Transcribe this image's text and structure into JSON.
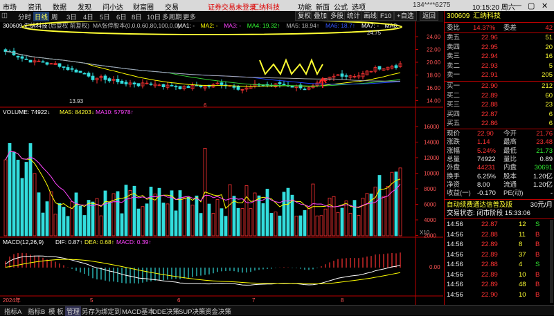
{
  "menubar": {
    "items": [
      "市场",
      "资讯",
      "数据",
      "发现",
      "问小达",
      "财富圈",
      "交易"
    ],
    "login_notice": "证券交易未登录",
    "stock_name": "汇纳科技",
    "right_items": [
      "功能",
      "新面",
      "公式",
      "选项"
    ],
    "time": "10:15:20 周六",
    "account": "134****6275"
  },
  "toolbar": {
    "left_items": [
      "分时",
      "日线",
      "周",
      "3日",
      "4日",
      "5日",
      "6日",
      "8日",
      "10日",
      "多周期",
      "更多"
    ],
    "active": "日线",
    "right_items": [
      "复权",
      "叠加",
      "多股",
      "统计",
      "画线",
      "F10",
      "+自选",
      "返回"
    ]
  },
  "main_chart": {
    "header_code_name": "300609 汇纳科技",
    "header_adj": "(后复权 前复权)",
    "ma_formula": "MA张停股本(0,0,0,60,80,100,0,0)",
    "ma_values": [
      {
        "label": "MA1: -",
        "color": "#ffffff"
      },
      {
        "label": "MA2: -",
        "color": "#ffff00"
      },
      {
        "label": "MA3: -",
        "color": "#ff44ff"
      },
      {
        "label": "MA4: 19.32↑",
        "color": "#33ff33"
      },
      {
        "label": "MA5: 18.94↑",
        "color": "#bbbbbb"
      },
      {
        "label": "MA6: 18.7↑",
        "color": "#3355ff"
      },
      {
        "label": "MA7: -",
        "color": "#ffffff"
      },
      {
        "label": "MA8: -",
        "color": "#ffffff"
      }
    ],
    "y_ticks": [
      "24.00",
      "22.00",
      "20.00",
      "18.00",
      "16.00",
      "14.00"
    ],
    "high_label": "24.75",
    "low_label": "13.93",
    "month_marker": "6"
  },
  "volume_chart": {
    "header": "VOLUME: 74922↓",
    "ma5": "MA5: 84203↓",
    "ma10": "MA10: 57978↑",
    "y_ticks": [
      "16000",
      "14000",
      "12000",
      "10000",
      "8000",
      "6000",
      "4000",
      "2000"
    ],
    "unit": "X10"
  },
  "macd_chart": {
    "header": "MACD(12,26,9)",
    "dif": "DIF: 0.87↑",
    "dea": "DEA: 0.68↑",
    "macd": "MACD: 0.39↑",
    "y_ticks": [
      "0.00"
    ],
    "x_labels": [
      "2024年",
      "5",
      "6",
      "7",
      "8"
    ]
  },
  "bottom_tabs": [
    "指标A",
    "指标B",
    "模 板",
    "管理",
    "另存为",
    "绑定到",
    "MACD基本",
    "DDE决策",
    "SUP决策",
    "资金决策"
  ],
  "right_panel": {
    "code": "300609",
    "name": "汇纳科技",
    "webi_label": "委比",
    "webi_value": "14.37%",
    "weicha_label": "委差",
    "weicha_value": "42",
    "asks": [
      {
        "label": "卖五",
        "price": "22.96",
        "vol": "51"
      },
      {
        "label": "卖四",
        "price": "22.95",
        "vol": "20"
      },
      {
        "label": "卖三",
        "price": "22.94",
        "vol": "16"
      },
      {
        "label": "卖二",
        "price": "22.93",
        "vol": "5"
      },
      {
        "label": "卖一",
        "price": "22.91",
        "vol": "205"
      }
    ],
    "bids": [
      {
        "label": "买一",
        "price": "22.90",
        "vol": "212"
      },
      {
        "label": "买二",
        "price": "22.89",
        "vol": "60"
      },
      {
        "label": "买三",
        "price": "22.88",
        "vol": "23"
      },
      {
        "label": "买四",
        "price": "22.87",
        "vol": "6"
      },
      {
        "label": "买五",
        "price": "22.86",
        "vol": "6"
      }
    ],
    "quote": [
      {
        "l1": "现价",
        "v1": "22.90",
        "l2": "今开",
        "v2": "21.76"
      },
      {
        "l1": "涨跌",
        "v1": "1.14",
        "l2": "最高",
        "v2": "23.48"
      },
      {
        "l1": "涨幅",
        "v1": "5.24%",
        "l2": "最低",
        "v2": "21.73"
      },
      {
        "l1": "总量",
        "v1": "74922",
        "l2": "量比",
        "v2": "0.89"
      },
      {
        "l1": "外盘",
        "v1": "44231",
        "l2": "内盘",
        "v2": "30691"
      },
      {
        "l1": "换手",
        "v1": "6.25%",
        "l2": "股本",
        "v2": "1.20亿"
      },
      {
        "l1": "净资",
        "v1": "8.00",
        "l2": "流通",
        "v2": "1.20亿"
      },
      {
        "l1": "收益(一)",
        "v1": "-0.170",
        "l2": "PE(动)",
        "v2": "-"
      }
    ],
    "ad": "自动续费通达信普及版",
    "ad_price": "30元/月",
    "trade_status": "交易状态: 闭市阶段 15:33:06",
    "ticks": [
      {
        "t": "14:56",
        "p": "22.87",
        "v": "12",
        "d": "S"
      },
      {
        "t": "14:56",
        "p": "22.88",
        "v": "11",
        "d": "B"
      },
      {
        "t": "14:56",
        "p": "22.89",
        "v": "8",
        "d": "B"
      },
      {
        "t": "14:56",
        "p": "22.89",
        "v": "37",
        "d": "B"
      },
      {
        "t": "14:56",
        "p": "22.88",
        "v": "4",
        "d": "S"
      },
      {
        "t": "14:56",
        "p": "22.89",
        "v": "10",
        "d": "B"
      },
      {
        "t": "14:56",
        "p": "22.89",
        "v": "48",
        "d": "B"
      },
      {
        "t": "14:56",
        "p": "22.90",
        "v": "10",
        "d": "B"
      }
    ]
  },
  "colors": {
    "up": "#ff3333",
    "down": "#33dddd",
    "ma_yellow": "#ffff00",
    "ma_green": "#33cc33",
    "ma_blue": "#2244ff",
    "ma_gray": "#aaaaaa",
    "annotation": "#ffff33"
  }
}
